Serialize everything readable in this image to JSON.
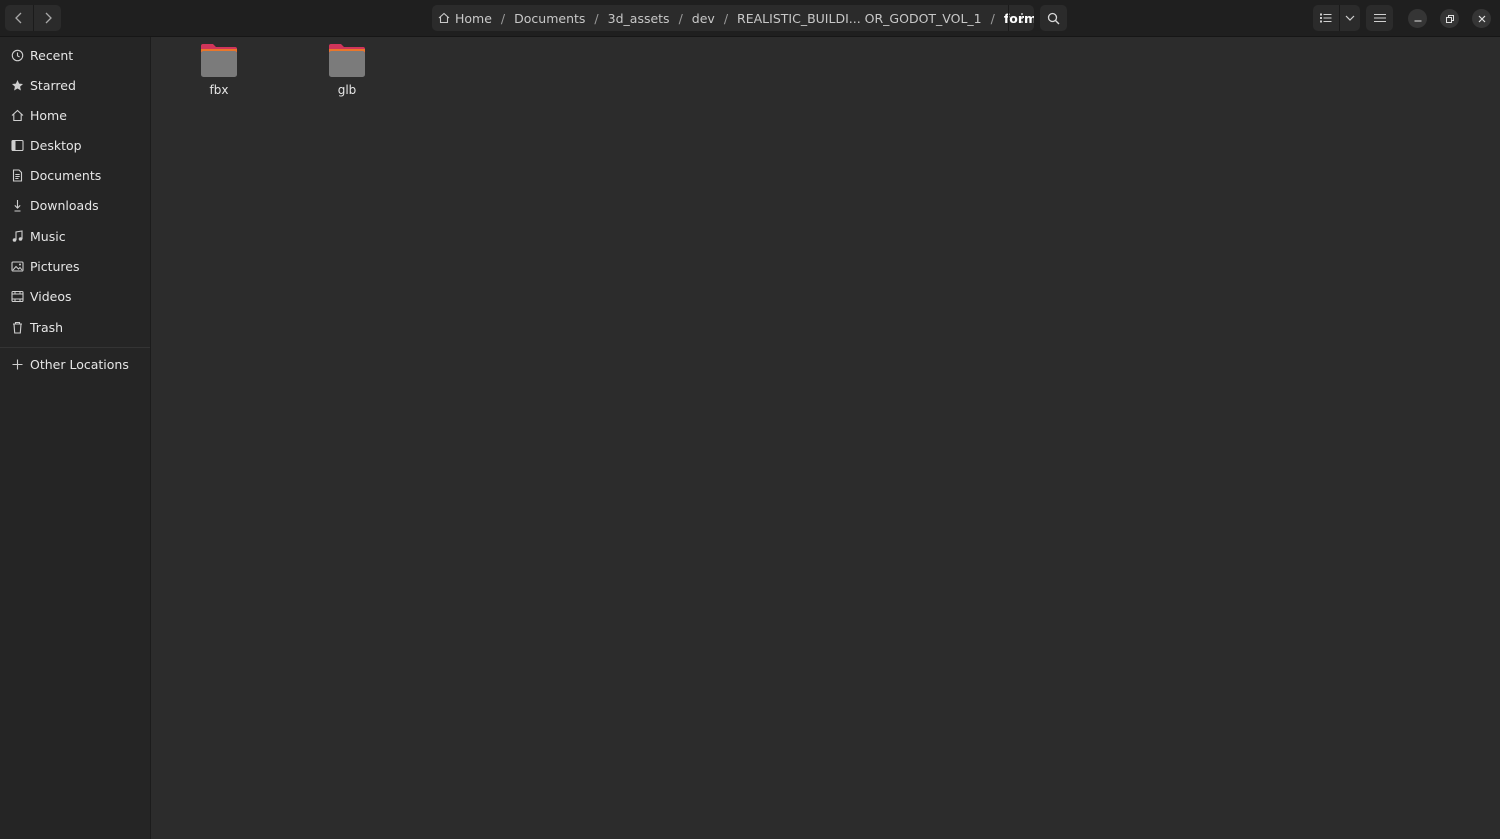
{
  "header": {
    "breadcrumbs": [
      "Home",
      "Documents",
      "3d_assets",
      "dev",
      "REALISTIC_BUILDI... OR_GODOT_VOL_1",
      "formats"
    ],
    "separator": "/"
  },
  "sidebar": {
    "items": [
      {
        "label": "Recent",
        "icon": "clock-icon"
      },
      {
        "label": "Starred",
        "icon": "star-icon"
      },
      {
        "label": "Home",
        "icon": "home-icon"
      },
      {
        "label": "Desktop",
        "icon": "desktop-icon"
      },
      {
        "label": "Documents",
        "icon": "document-icon"
      },
      {
        "label": "Downloads",
        "icon": "download-icon"
      },
      {
        "label": "Music",
        "icon": "music-icon"
      },
      {
        "label": "Pictures",
        "icon": "picture-icon"
      },
      {
        "label": "Videos",
        "icon": "video-icon"
      },
      {
        "label": "Trash",
        "icon": "trash-icon"
      }
    ],
    "other_locations": {
      "label": "Other Locations",
      "icon": "plus-icon"
    }
  },
  "files": [
    {
      "name": "fbx",
      "type": "folder"
    },
    {
      "name": "glb",
      "type": "folder"
    }
  ],
  "colors": {
    "folder_tab": "#d0355a",
    "folder_accent": "#e9762b",
    "folder_body": "#7b7b7b"
  }
}
